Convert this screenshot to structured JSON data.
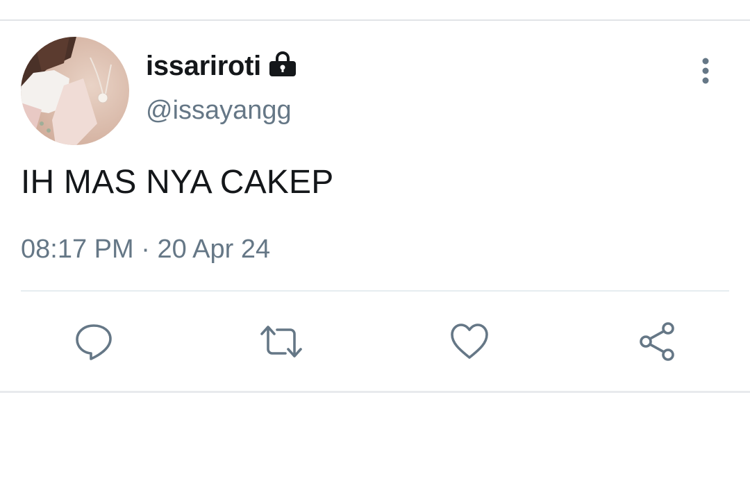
{
  "tweet": {
    "display_name": "issariroti",
    "handle": "@issayangg",
    "text": "IH MAS NYA CAKEP",
    "time": "08:17 PM",
    "separator": "·",
    "date": "20 Apr 24",
    "protected": true
  },
  "icons": {
    "lock": "lock-icon",
    "more": "more-vertical-icon",
    "reply": "reply-icon",
    "retweet": "retweet-icon",
    "like": "heart-icon",
    "share": "share-icon"
  },
  "colors": {
    "text_primary": "#14171a",
    "text_secondary": "#657786",
    "icon": "#657786",
    "divider": "#e6ecf0"
  }
}
